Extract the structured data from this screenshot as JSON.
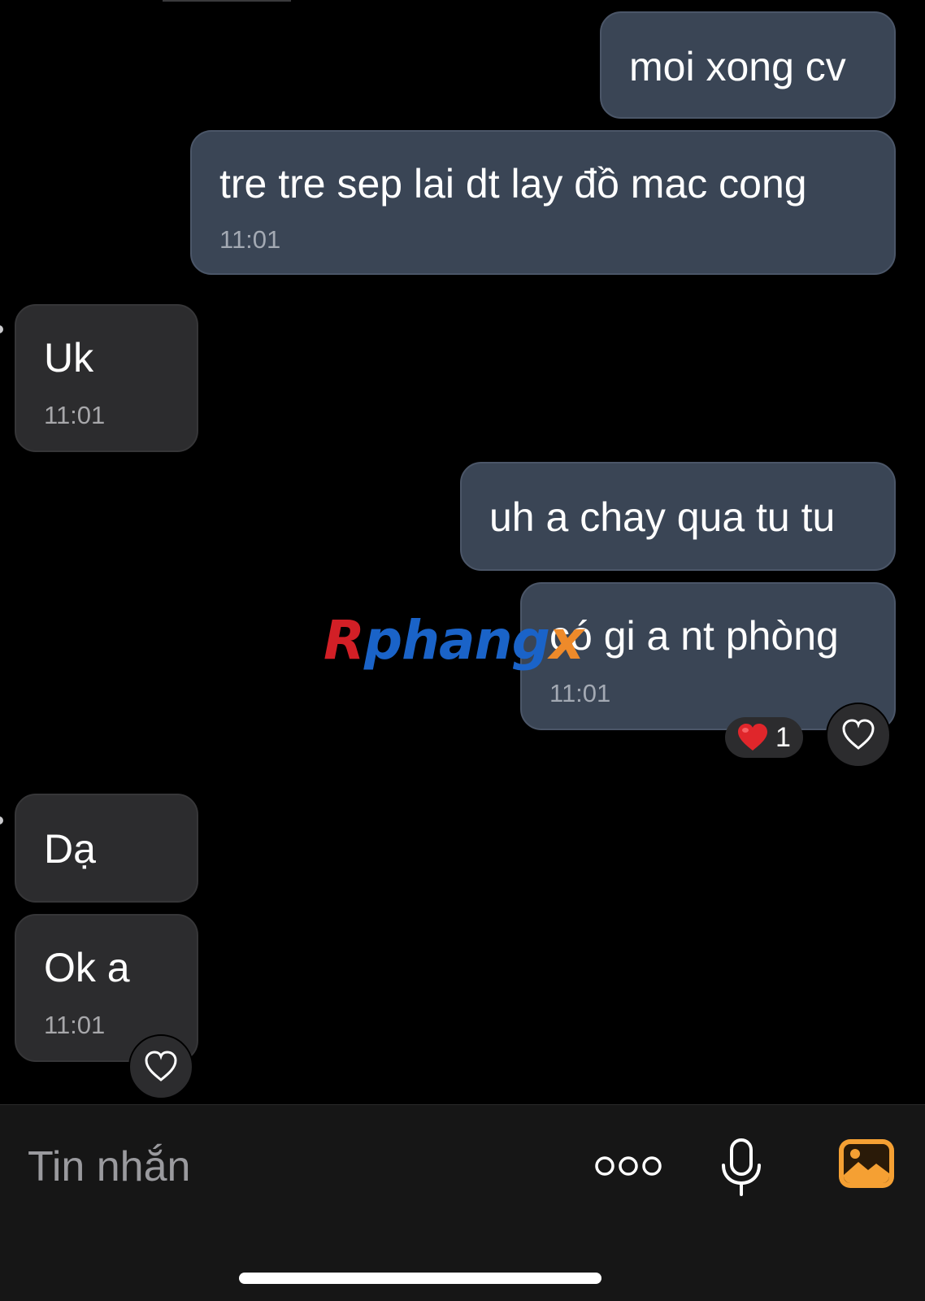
{
  "messages": [
    {
      "id": "m1",
      "direction": "outgoing",
      "text": "moi xong cv",
      "time": ""
    },
    {
      "id": "m2",
      "direction": "outgoing",
      "text": "tre tre sep lai dt lay đồ mac cong",
      "time": "11:01"
    },
    {
      "id": "m3",
      "direction": "incoming",
      "text": "Uk",
      "time": "11:01"
    },
    {
      "id": "m4",
      "direction": "outgoing",
      "text": "uh a chay qua tu tu",
      "time": ""
    },
    {
      "id": "m5",
      "direction": "outgoing",
      "text": "có gi a nt phòng",
      "time": "11:01",
      "reaction": {
        "emoji": "❤️",
        "count": "1"
      }
    },
    {
      "id": "m6",
      "direction": "incoming",
      "text": "Dạ",
      "time": ""
    },
    {
      "id": "m7",
      "direction": "incoming",
      "text": "Ok a",
      "time": "11:01"
    }
  ],
  "watermark": {
    "part1": "R",
    "part2": "phang",
    "part3": "x"
  },
  "composer": {
    "placeholder": "Tin nhắn",
    "icons": [
      "more-dots-icon",
      "microphone-icon",
      "photo-icon"
    ]
  },
  "colors": {
    "background": "#000000",
    "outgoing_bubble": "#3a4555",
    "incoming_bubble": "#2c2c2e",
    "composer_background": "#161616",
    "photo_icon_accent": "#f5a033",
    "reaction_heart": "#e0262b"
  }
}
